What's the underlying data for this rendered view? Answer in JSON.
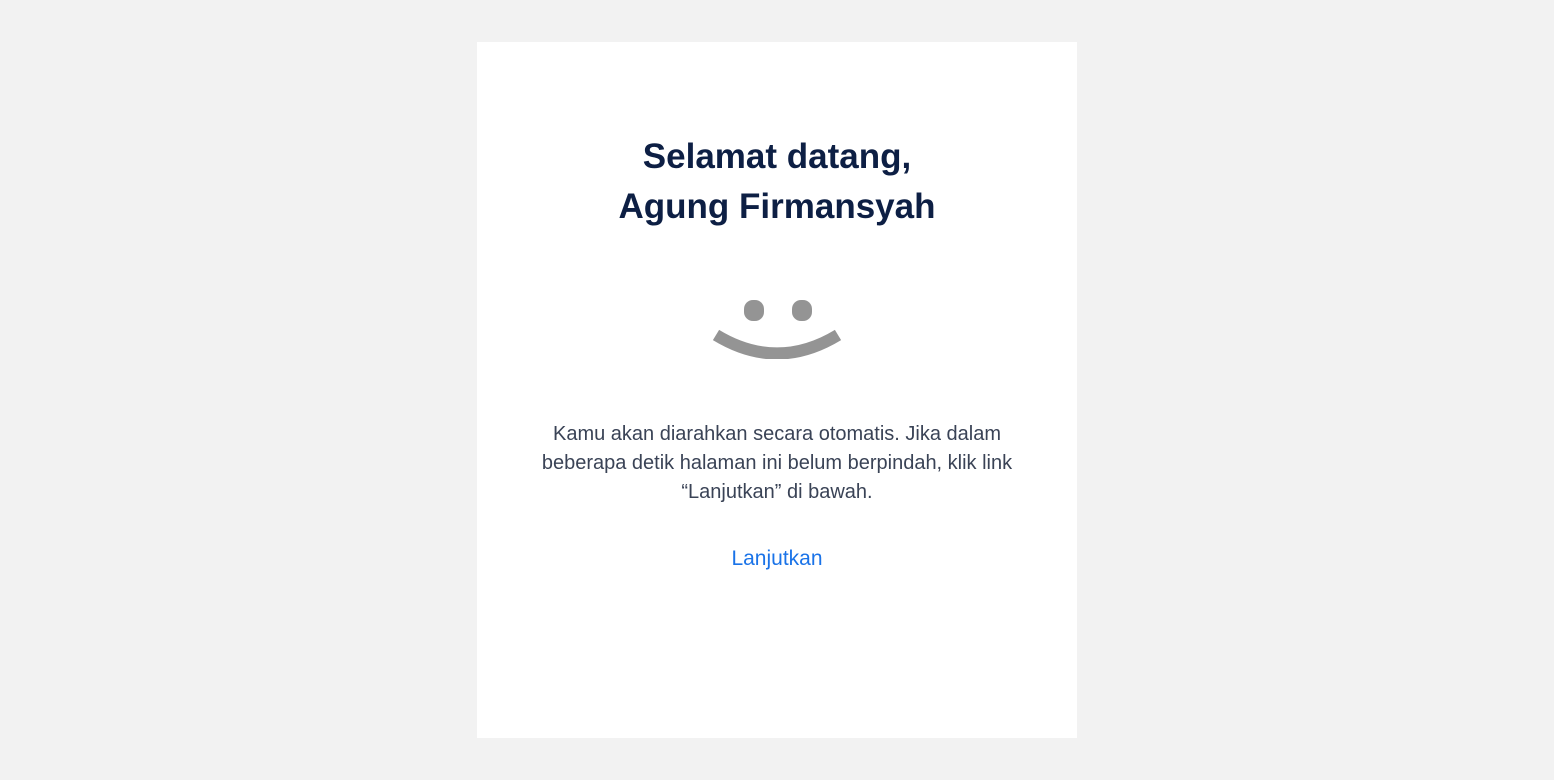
{
  "welcome": {
    "greeting": "Selamat datang,",
    "user_name": "Agung Firmansyah"
  },
  "illustration": {
    "icon": "smiley-face-icon",
    "color": "#949494"
  },
  "message": {
    "text": "Kamu akan diarahkan secara otomatis. Jika dalam beberapa detik halaman ini belum berpindah, klik link “Lanjutkan” di bawah."
  },
  "actions": {
    "continue_label": "Lanjutkan"
  },
  "colors": {
    "background": "#f2f2f2",
    "card": "#ffffff",
    "title": "#0d1f44",
    "body_text": "#3a4356",
    "link": "#1a73e8"
  }
}
